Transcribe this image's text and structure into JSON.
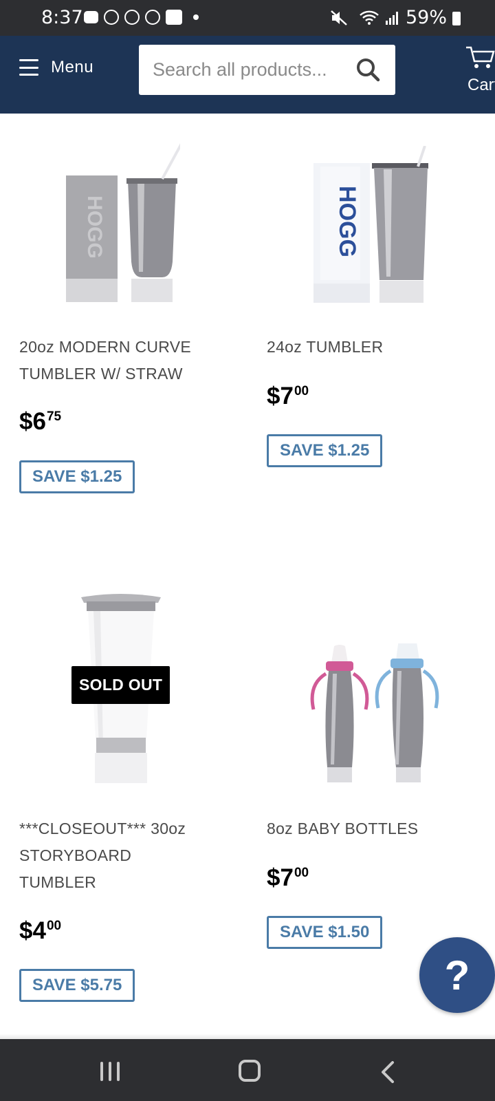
{
  "status": {
    "time": "8:37",
    "battery": "59%"
  },
  "header": {
    "menu_label": "Menu",
    "search_placeholder": "Search all products...",
    "cart_label": "Cart"
  },
  "products": [
    {
      "title_lines": [
        "20oz MODERN CURVE",
        "TUMBLER W/ STRAW"
      ],
      "price_dollars": "$6",
      "price_cents": "75",
      "save": "SAVE $1.25",
      "sold_out": ""
    },
    {
      "title_lines": [
        "24oz TUMBLER"
      ],
      "price_dollars": "$7",
      "price_cents": "00",
      "save": "SAVE $1.25",
      "sold_out": ""
    },
    {
      "title_lines": [
        "***CLOSEOUT*** 30oz",
        "STORYBOARD",
        "TUMBLER"
      ],
      "price_dollars": "$4",
      "price_cents": "00",
      "save": "SAVE $5.75",
      "sold_out": "SOLD OUT"
    },
    {
      "title_lines": [
        "8oz BABY BOTTLES"
      ],
      "price_dollars": "$7",
      "price_cents": "00",
      "save": "SAVE $1.50",
      "sold_out": ""
    }
  ],
  "help_label": "?",
  "colors": {
    "header_bg": "#1d3455",
    "save_accent": "#4a7ba7",
    "help_bg": "#2f4f85"
  }
}
